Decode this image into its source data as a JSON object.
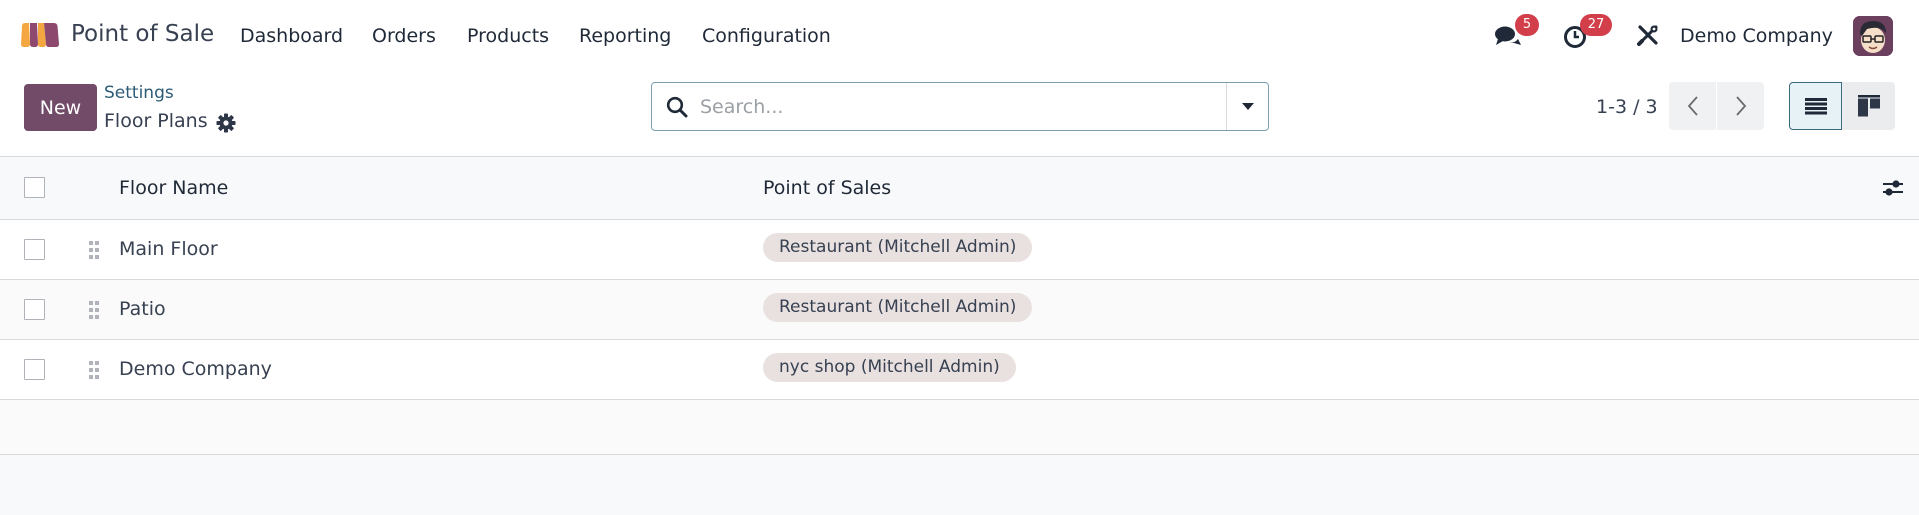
{
  "navbar": {
    "app_icon": "point-of-sale-awning-logo",
    "app_title": "Point of Sale",
    "menu": [
      {
        "label": "Dashboard"
      },
      {
        "label": "Orders"
      },
      {
        "label": "Products"
      },
      {
        "label": "Reporting"
      },
      {
        "label": "Configuration"
      }
    ],
    "messages_icon": "chat-bubbles-icon",
    "messages_count": "5",
    "activities_icon": "clock-icon",
    "activities_count": "27",
    "debug_icon": "tools-icon",
    "company": "Demo Company",
    "avatar": "user-avatar"
  },
  "control_panel": {
    "new_label": "New",
    "breadcrumb_parent": "Settings",
    "breadcrumb_current": "Floor Plans",
    "search_placeholder": "Search...",
    "search_value": "",
    "pager_value": "1-3 / 3",
    "active_view": "list",
    "views": [
      "list",
      "kanban"
    ]
  },
  "table": {
    "columns": [
      "Floor Name",
      "Point of Sales"
    ],
    "rows": [
      {
        "floor_name": "Main Floor",
        "point_of_sales": [
          "Restaurant (Mitchell Admin)"
        ]
      },
      {
        "floor_name": "Patio",
        "point_of_sales": [
          "Restaurant (Mitchell Admin)"
        ]
      },
      {
        "floor_name": "Demo Company",
        "point_of_sales": [
          "nyc shop (Mitchell Admin)"
        ]
      }
    ]
  },
  "colors": {
    "brand": "#714b67",
    "badge": "#d23f4b",
    "tag_bg": "#e9e1e0",
    "link": "#2c5b76"
  }
}
